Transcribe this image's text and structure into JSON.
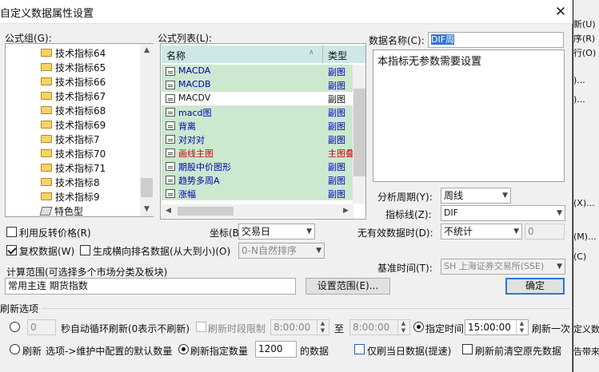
{
  "window": {
    "title": "自定义数据属性设置",
    "close": "✕"
  },
  "formula_group": {
    "label": "公式组(G):",
    "items": [
      "技术指标64",
      "技术指标65",
      "技术指标66",
      "技术指标67",
      "技术指标68",
      "技术指标69",
      "技术指标7",
      "技术指标70",
      "技术指标71",
      "技术指标8",
      "技术指标9",
      "特色型"
    ]
  },
  "formula_list": {
    "label": "公式列表(L):",
    "col_name": "名称",
    "col_type": "类型",
    "rows": [
      {
        "name": "MACDA",
        "type": "副图",
        "color": "#0000b4",
        "sel": true
      },
      {
        "name": "MACDB",
        "type": "副图",
        "color": "#0000b4",
        "sel": true
      },
      {
        "name": "MACDV",
        "type": "副图",
        "color": "#111111",
        "sel": false
      },
      {
        "name": "macd图",
        "type": "副图",
        "color": "#0000b4",
        "sel": true
      },
      {
        "name": "背离",
        "type": "副图",
        "color": "#0000b4",
        "sel": true
      },
      {
        "name": "对对对",
        "type": "副图",
        "color": "#0000b4",
        "sel": true
      },
      {
        "name": "画线主图",
        "type": "主图叠",
        "color": "#d20000",
        "sel": true
      },
      {
        "name": "期股中价图形",
        "type": "副图",
        "color": "#0000b4",
        "sel": true
      },
      {
        "name": "趋势多周A",
        "type": "副图",
        "color": "#0000b4",
        "sel": true
      },
      {
        "name": "涨幅",
        "type": "副图",
        "color": "#0000b4",
        "sel": true
      }
    ]
  },
  "data_name": {
    "label": "数据名称(C):",
    "value": "DIF周"
  },
  "description": "本指标无参数需要设置",
  "period": {
    "label": "分析周期(Y):",
    "value": "周线"
  },
  "indicator_line": {
    "label": "指标线(Z):",
    "value": "DIF"
  },
  "invalid_time": {
    "label": "无有效数据时(D):",
    "value": "不统计",
    "extra": "0"
  },
  "base_time": {
    "label": "基准时间(T):",
    "value": "SH 上海证券交易所(SSE)"
  },
  "options": {
    "reverse_price": "利用反转价格(R)",
    "coord_label": "坐标(B):",
    "coord_value": "交易日",
    "restore_rights": "复权数据(W)",
    "rank": "生成横向排名数据(从大到小)(O)",
    "rank_value": "0-N自然排序"
  },
  "calc_range": {
    "label": "计算范围(可选择多个市场分类及板块)",
    "value": "常用主连  期货指数",
    "set_button": "设置范围(E)...",
    "ok_button": "确定"
  },
  "refresh": {
    "title": "刷新选项",
    "seconds_value": "0",
    "seconds_label": "秒自动循环刷新(0表示不刷新)",
    "period_limit": "刷新时段限制",
    "from": "8:00:00",
    "to_label": "至",
    "to": "8:00:00",
    "fixed_time": "指定时间",
    "fixed_value": "15:00:00",
    "once": "刷新一次",
    "refresh_label": "刷新",
    "refresh_desc": "选项->维护中配置的默认数量",
    "count_label": "刷新指定数量",
    "count_value": "1200",
    "count_suffix": "的数据",
    "today_only": "仅刷当日数据(提速)",
    "clear_first": "刷新前清空原先数据"
  },
  "right_edge": [
    "新(U)",
    "序(R)",
    "行(O)",
    ")...",
    ")...",
    "(X)...",
    "(M)...",
    "(C)",
    "定义数",
    "告带来"
  ],
  "colors": {
    "selected_row": "#cce8cf",
    "highlight": "#cde8e6",
    "dialog_bg": "#f0f0f0"
  }
}
